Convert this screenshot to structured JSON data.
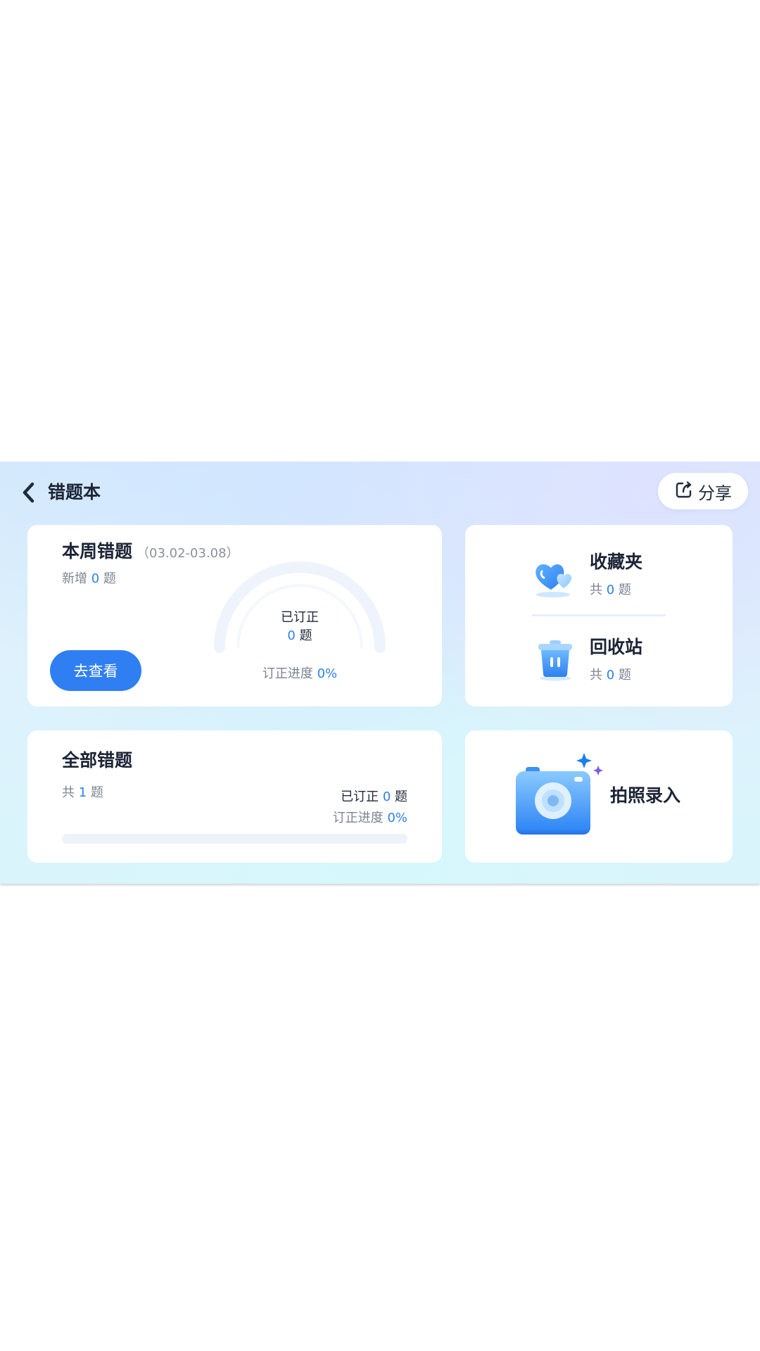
{
  "header": {
    "title": "错题本",
    "share_label": "分享"
  },
  "week_card": {
    "title": "本周错题",
    "date_range": "（03.02-03.08）",
    "new_prefix": "新增",
    "new_count": "0",
    "unit": "题",
    "button_label": "去查看",
    "gauge_label": "已订正",
    "gauge_count": "0",
    "gauge_unit": "题",
    "progress_label": "订正进度",
    "progress_value": "0%",
    "progress_fraction": 0
  },
  "favorites": {
    "title": "收藏夹",
    "prefix": "共",
    "count": "0",
    "unit": "题"
  },
  "recycle": {
    "title": "回收站",
    "prefix": "共",
    "count": "0",
    "unit": "题"
  },
  "all_card": {
    "title": "全部错题",
    "prefix": "共",
    "count": "1",
    "unit": "题",
    "corrected_label": "已订正",
    "corrected_count": "0",
    "corrected_unit": "题",
    "progress_label": "订正进度",
    "progress_value": "0%",
    "progress_fraction": 0
  },
  "photo_card": {
    "label": "拍照录入"
  },
  "colors": {
    "accent": "#2e7ff0",
    "button": "#2f7ff3",
    "title_text": "#1c2436",
    "muted_text": "#7b8392"
  },
  "icons": [
    "back-arrow-icon",
    "share-icon",
    "heart-icon",
    "trash-icon",
    "camera-icon"
  ]
}
